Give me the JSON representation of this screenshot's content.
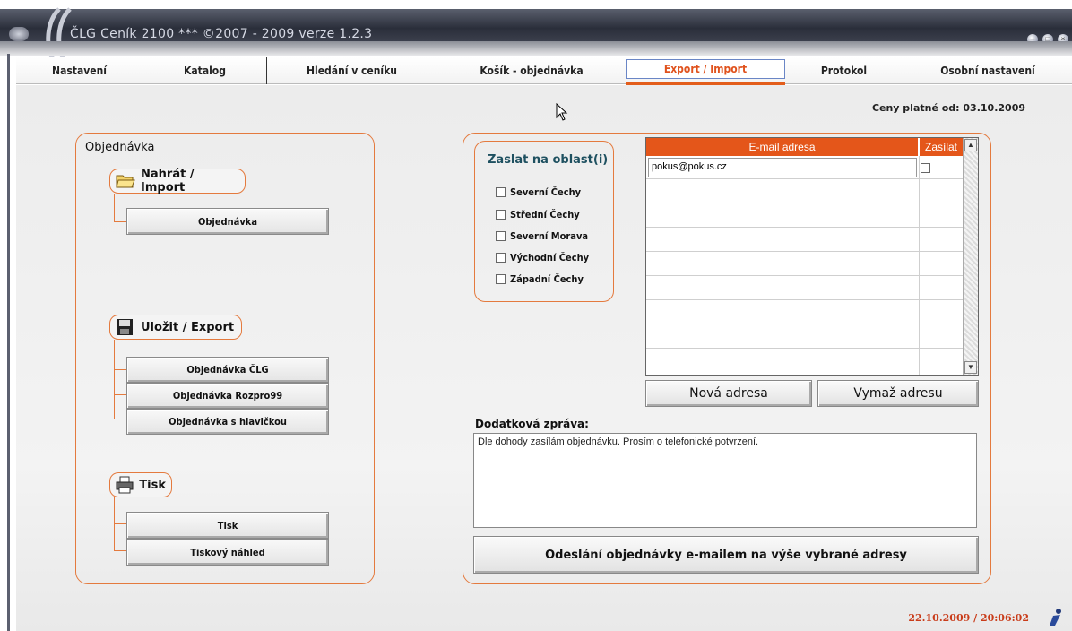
{
  "window": {
    "title": "ČLG Ceník 2100 *** ©2007 - 2009   verze 1.2.3"
  },
  "tabs": [
    {
      "label": "Nastavení"
    },
    {
      "label": "Katalog"
    },
    {
      "label": "Hledání v ceníku"
    },
    {
      "label": "Košík - objednávka"
    },
    {
      "label": "Export / Import",
      "active": true
    },
    {
      "label": "Protokol"
    },
    {
      "label": "Osobní nastavení"
    }
  ],
  "prices_valid": "Ceny platné od:  03.10.2009",
  "left_panel": {
    "title": "Objednávka",
    "import": {
      "header": "Nahrát / Import",
      "buttons": [
        "Objednávka"
      ]
    },
    "export": {
      "header": "Uložit / Export",
      "buttons": [
        "Objednávka ČLG",
        "Objednávka Rozpro99",
        "Objednávka s hlavičkou"
      ]
    },
    "print": {
      "header": "Tisk",
      "buttons": [
        "Tisk",
        "Tiskový náhled"
      ]
    }
  },
  "region": {
    "title": "Zaslat na oblast(i)",
    "items": [
      "Severní Čechy",
      "Střední Čechy",
      "Severní Morava",
      "Východní Čechy",
      "Západní Čechy"
    ]
  },
  "email_grid": {
    "col_email": "E-mail adresa",
    "col_send": "Zasílat",
    "rows": [
      {
        "email": "pokus@pokus.cz",
        "send": false
      }
    ]
  },
  "buttons": {
    "new_address": "Nová adresa",
    "delete_address": "Vymaž adresu",
    "send_order": "Odeslání objednávky e-mailem na výše vybrané adresy"
  },
  "message": {
    "label": "Dodatková zpráva:",
    "value": "Dle dohody zasílám objednávku. Prosím o telefonické potvrzení."
  },
  "status_datetime": "22.10.2009 / 20:06:02",
  "colors": {
    "accent": "#e4561a",
    "panel_border": "#e47a3e",
    "titlebar": "#2a2e3a"
  }
}
